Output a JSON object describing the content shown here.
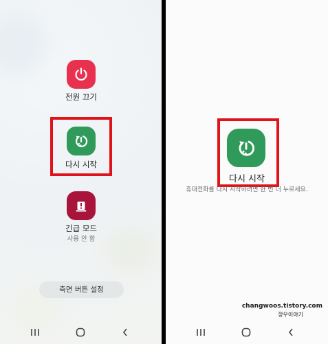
{
  "left_panel": {
    "power_off": {
      "label": "전원 끄기",
      "color": "#e8314f"
    },
    "restart": {
      "label": "다시 시작",
      "color": "#2f9a5a"
    },
    "emergency": {
      "label": "긴급 모드",
      "sublabel": "사용 안 함",
      "color": "#a8143a"
    },
    "side_button_settings": {
      "label": "측면 버튼 설정"
    }
  },
  "right_panel": {
    "restart": {
      "label": "다시 시작",
      "color": "#2f9a5a"
    },
    "hint": "휴대전화를 다시 시작하려면 한 번 더 누르세요.",
    "watermark_url": "changwoos.tistory.com",
    "watermark_name": "깡우이야기"
  },
  "highlight_color": "#e0131a"
}
